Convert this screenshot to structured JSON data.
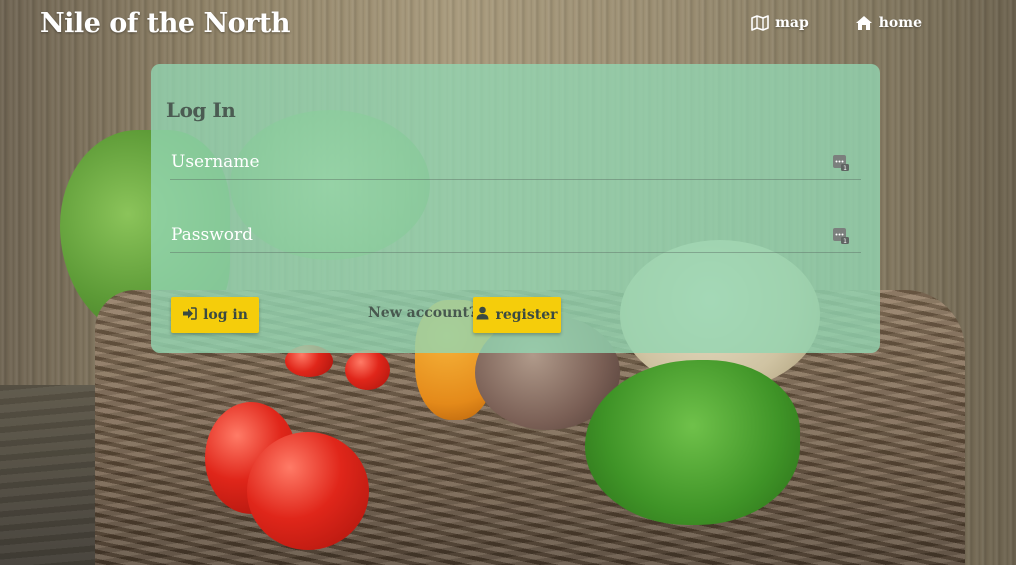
{
  "header": {
    "site_title": "Nile of the North",
    "nav": [
      {
        "label": "map",
        "icon": "map-icon"
      },
      {
        "label": "home",
        "icon": "home-icon"
      }
    ]
  },
  "login": {
    "title": "Log In",
    "username_placeholder": "Username",
    "username_value": "",
    "password_placeholder": "Password",
    "password_value": "",
    "login_button": "log in",
    "new_account_text": "New account?",
    "register_button": "register"
  },
  "colors": {
    "card": "#92d6b2",
    "button": "#f5cd0b",
    "button_text": "#3b4a42",
    "title_text": "#4b5b52",
    "header_text": "#ffffff"
  }
}
